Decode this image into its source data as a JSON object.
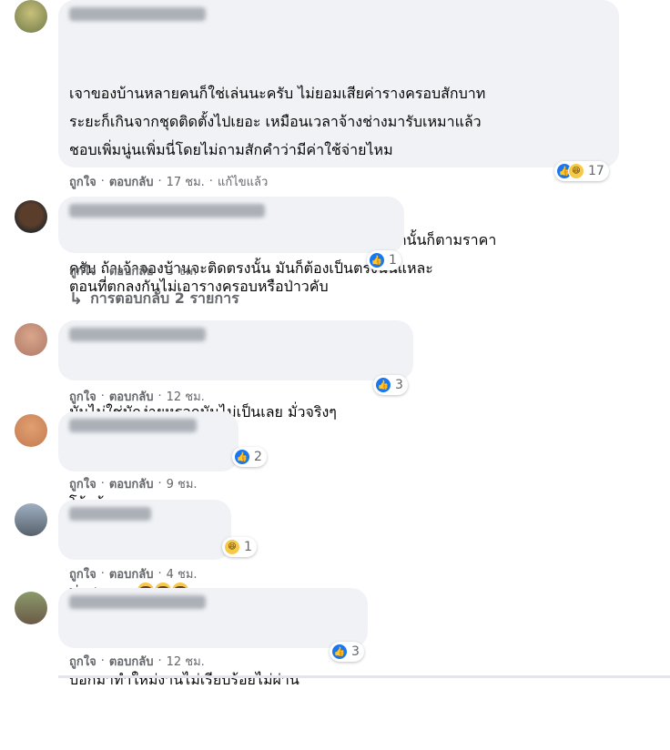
{
  "comments": [
    {
      "paragraphs": [
        "เจาของบ้านหลายคนก็ใช่เล่นนะครับ ไม่ยอมเสียค่ารางครอบสักบาท\nระยะก็เกินจากชุดติดตั้งไปเยอะ เหมือนเวลาจ้างช่างมารับเหมาแล้ว\nชอบเพิ่มนู่นเพิ่มนี่โดยไม่ถามสักคำว่ามีค่าใช้จ่ายไหม",
        "ดูจากรูปติดตั้งคืองานหยาบที่รอยเจาะ ไม่มีเก็บรูให้นอกนั้นก็ตามราคา\nครับ ถ้าเจ้าจองบ้านจะติดตรงนั้น มันก็ต้องเป็นตรงนั้นแหละ"
      ],
      "reaction_count": "17",
      "reactions": [
        "like",
        "haha"
      ],
      "like_label": "ถูกใจ",
      "reply_label": "ตอบกลับ",
      "time": "17 ชม.",
      "edited": "แก้ไขแล้ว"
    },
    {
      "paragraphs": [
        "ตอนที่ตกลงกันไม่เอารางครอบหรือป่าวคับ"
      ],
      "reaction_count": "1",
      "reactions": [
        "like"
      ],
      "like_label": "ถูกใจ",
      "reply_label": "ตอบกลับ",
      "time": "3 ชม."
    },
    {
      "paragraphs": [
        "มันไม่ใช่มักง่ายหรอกมันไม่เป็นเลย มั่วจริงๆ"
      ],
      "reaction_count": "3",
      "reactions": [
        "like"
      ],
      "like_label": "ถูกใจ",
      "reply_label": "ตอบกลับ",
      "time": "12 ชม."
    },
    {
      "paragraphs": [
        "โอ้ยน้อ"
      ],
      "reaction_count": "2",
      "reactions": [
        "like"
      ],
      "like_label": "ถูกใจ",
      "reply_label": "ตอบกลับ",
      "time": "9 ชม."
    },
    {
      "paragraphs": [
        "ท่อสูตรเลย"
      ],
      "reaction_count": "1",
      "reactions": [
        "haha"
      ],
      "like_label": "ถูกใจ",
      "reply_label": "ตอบกลับ",
      "time": "4 ชม."
    },
    {
      "paragraphs": [
        "บอกมาทำใหม่งานไม่เรียบร้อยไม่ผ่าน"
      ],
      "reaction_count": "3",
      "reactions": [
        "like"
      ],
      "like_label": "ถูกใจ",
      "reply_label": "ตอบกลับ",
      "time": "12 ชม."
    }
  ],
  "replies_link": "การตอบกลับ 2 รายการ",
  "separator": "·",
  "icons": {
    "like": "like-icon",
    "haha": "haha-icon",
    "reply_arrow": "reply-arrow-icon"
  },
  "colors": {
    "bubble_bg": "#f0f2f5",
    "like_blue": "#1877f2",
    "haha_yellow": "#f7c948",
    "meta_gray": "#65676b"
  }
}
